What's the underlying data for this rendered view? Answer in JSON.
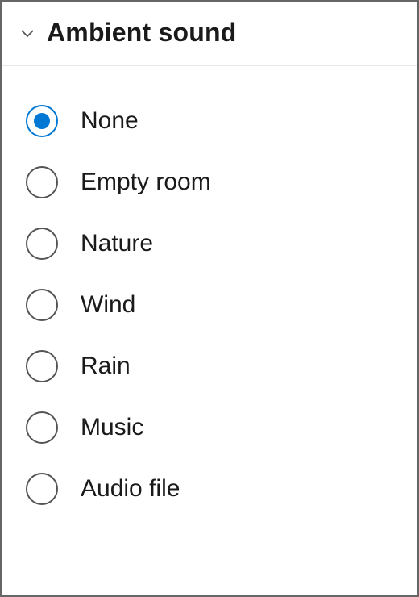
{
  "section": {
    "title": "Ambient sound",
    "expanded": true
  },
  "options": [
    {
      "id": "none",
      "label": "None",
      "selected": true
    },
    {
      "id": "empty-room",
      "label": "Empty room",
      "selected": false
    },
    {
      "id": "nature",
      "label": "Nature",
      "selected": false
    },
    {
      "id": "wind",
      "label": "Wind",
      "selected": false
    },
    {
      "id": "rain",
      "label": "Rain",
      "selected": false
    },
    {
      "id": "music",
      "label": "Music",
      "selected": false
    },
    {
      "id": "audio-file",
      "label": "Audio file",
      "selected": false
    }
  ],
  "colors": {
    "accent": "#0078d4",
    "border": "#666",
    "divider": "#e6e6e6",
    "text": "#1a1a1a"
  }
}
